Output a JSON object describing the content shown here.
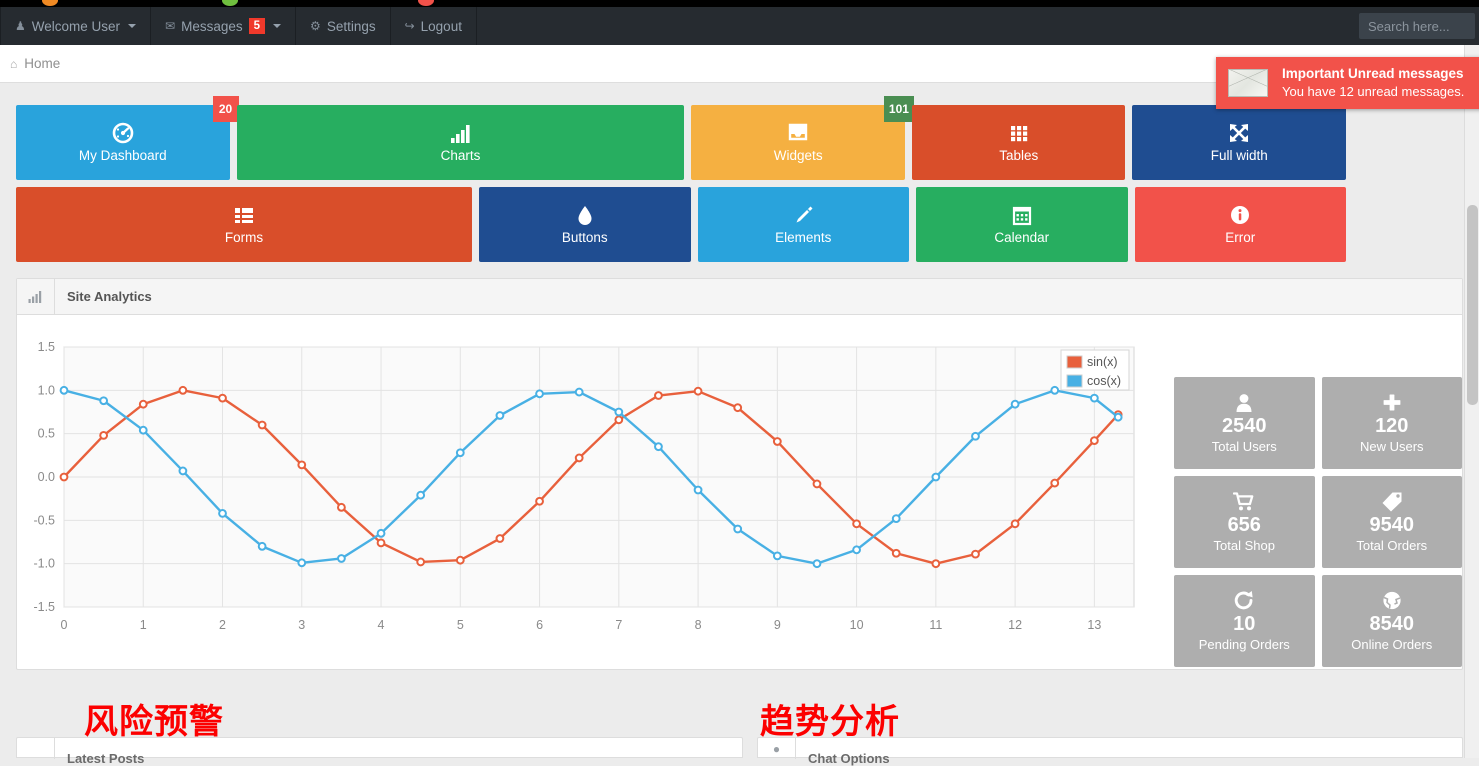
{
  "browser": {
    "tab_dots": [
      "#f08a24",
      "#6fbf3f",
      "#f2524a"
    ]
  },
  "navbar": {
    "items": [
      {
        "name": "welcome-user",
        "icon": "user-icon",
        "glyph": "♟",
        "label": "Welcome User",
        "caret": true,
        "badge": null
      },
      {
        "name": "messages",
        "icon": "envelope-icon",
        "glyph": "✉",
        "label": "Messages",
        "caret": true,
        "badge": "5"
      },
      {
        "name": "settings",
        "icon": "gear-icon",
        "glyph": "⚙",
        "label": "Settings",
        "caret": false,
        "badge": null
      },
      {
        "name": "logout",
        "icon": "logout-icon",
        "glyph": "↪",
        "label": "Logout",
        "caret": false,
        "badge": null
      }
    ],
    "badge_color": "#f0392b",
    "background": "#262b30"
  },
  "search": {
    "placeholder": "Search here...",
    "value": ""
  },
  "breadcrumb": {
    "icon": "home-icon",
    "glyph": "⌂",
    "label": "Home"
  },
  "toast": {
    "icon": "envelope-icon",
    "title": "Important Unread messages",
    "body": "You have 12 unread messages.",
    "color": "#f2524a"
  },
  "tiles": {
    "row1": [
      {
        "label": "My Dashboard",
        "icon": "dashboard-gauge-icon",
        "glyph": "◔",
        "color": "#29a3dc",
        "badge": "20",
        "badge_color": "#f2524a",
        "flex": 2.05
      },
      {
        "label": "Charts",
        "icon": "bar-chart-icon",
        "glyph": "ᵜ",
        "color": "#27ae60",
        "badge": null,
        "badge_color": null,
        "flex": 4.3
      },
      {
        "label": "Widgets",
        "icon": "inbox-icon",
        "glyph": "☰",
        "color": "#f5b041",
        "badge": "101",
        "badge_color": "#4a8e52",
        "flex": 2.05
      },
      {
        "label": "Tables",
        "icon": "grid-icon",
        "glyph": "▒",
        "color": "#d94e2a",
        "badge": null,
        "badge_color": null,
        "flex": 2.05
      },
      {
        "label": "Full width",
        "icon": "expand-arrows-icon",
        "glyph": "✥",
        "color": "#1f4d91",
        "badge": null,
        "badge_color": null,
        "flex": 2.05
      }
    ],
    "row2": [
      {
        "label": "Forms",
        "icon": "list-icon",
        "glyph": "≣",
        "color": "#d94e2a",
        "flex": 4.42
      },
      {
        "label": "Buttons",
        "icon": "droplet-icon",
        "glyph": "●",
        "color": "#1f4d91",
        "flex": 2.05
      },
      {
        "label": "Elements",
        "icon": "pencil-icon",
        "glyph": "✎",
        "color": "#29a3dc",
        "flex": 2.05
      },
      {
        "label": "Calendar",
        "icon": "calendar-icon",
        "glyph": "▦",
        "color": "#27ae60",
        "flex": 2.05
      },
      {
        "label": "Error",
        "icon": "info-icon",
        "glyph": "ℹ",
        "color": "#f2524a",
        "flex": 2.05
      }
    ]
  },
  "panel": {
    "icon": "bar-chart-icon",
    "title": "Site Analytics"
  },
  "chart_data": {
    "type": "line",
    "title": "Site Analytics",
    "xlabel": "",
    "ylabel": "",
    "xlim": [
      0,
      13.5
    ],
    "ylim": [
      -1.5,
      1.5
    ],
    "grid": true,
    "legend_position": "top-right",
    "xticks": [
      0,
      1,
      2,
      3,
      4,
      5,
      6,
      7,
      8,
      9,
      10,
      11,
      12,
      13
    ],
    "yticks": [
      -1.5,
      -1.0,
      -0.5,
      0.0,
      0.5,
      1.0,
      1.5
    ],
    "ytick_labels": [
      "-1.5",
      "-1.0",
      "-0.5",
      "0.0",
      "0.5",
      "1.0",
      "1.5"
    ],
    "x": [
      0,
      0.5,
      1,
      1.5,
      2,
      2.5,
      3,
      3.5,
      4,
      4.5,
      5,
      5.5,
      6,
      6.5,
      7,
      7.5,
      8,
      8.5,
      9,
      9.5,
      10,
      10.5,
      11,
      11.5,
      12,
      12.5,
      13,
      13.3
    ],
    "series": [
      {
        "name": "sin(x)",
        "color": "#e8603c",
        "values": [
          0.0,
          0.48,
          0.84,
          1.0,
          0.91,
          0.6,
          0.14,
          -0.35,
          -0.76,
          -0.98,
          -0.96,
          -0.71,
          -0.28,
          0.22,
          0.66,
          0.94,
          0.99,
          0.8,
          0.41,
          -0.08,
          -0.54,
          -0.88,
          -1.0,
          -0.89,
          -0.54,
          -0.07,
          0.42,
          0.72
        ]
      },
      {
        "name": "cos(x)",
        "color": "#48b0e4",
        "values": [
          1.0,
          0.88,
          0.54,
          0.07,
          -0.42,
          -0.8,
          -0.99,
          -0.94,
          -0.65,
          -0.21,
          0.28,
          0.71,
          0.96,
          0.98,
          0.75,
          0.35,
          -0.15,
          -0.6,
          -0.91,
          -1.0,
          -0.84,
          -0.48,
          0.0,
          0.47,
          0.84,
          1.0,
          0.91,
          0.69
        ]
      }
    ]
  },
  "stats": [
    {
      "number": "2540",
      "label": "Total Users",
      "icon": "user-icon",
      "glyph": "♟"
    },
    {
      "number": "120",
      "label": "New Users",
      "icon": "plus-icon",
      "glyph": "✚"
    },
    {
      "number": "656",
      "label": "Total Shop",
      "icon": "cart-icon",
      "glyph": "⛃"
    },
    {
      "number": "9540",
      "label": "Total Orders",
      "icon": "tag-icon",
      "glyph": "◢"
    },
    {
      "number": "10",
      "label": "Pending Orders",
      "icon": "refresh-icon",
      "glyph": "↻"
    },
    {
      "number": "8540",
      "label": "Online Orders",
      "icon": "globe-icon",
      "glyph": "◑"
    }
  ],
  "bottom_panels": [
    {
      "title": "Latest Posts",
      "icon": "file-icon",
      "glyph": "☰"
    },
    {
      "title": "Chat Options",
      "icon": "chat-icon",
      "glyph": "●"
    }
  ],
  "annotations": [
    {
      "name": "risk-warning",
      "text": "风险预警",
      "color": "#fc0000"
    },
    {
      "name": "trend-analysis",
      "text": "趋势分析",
      "color": "#fc0000"
    }
  ]
}
